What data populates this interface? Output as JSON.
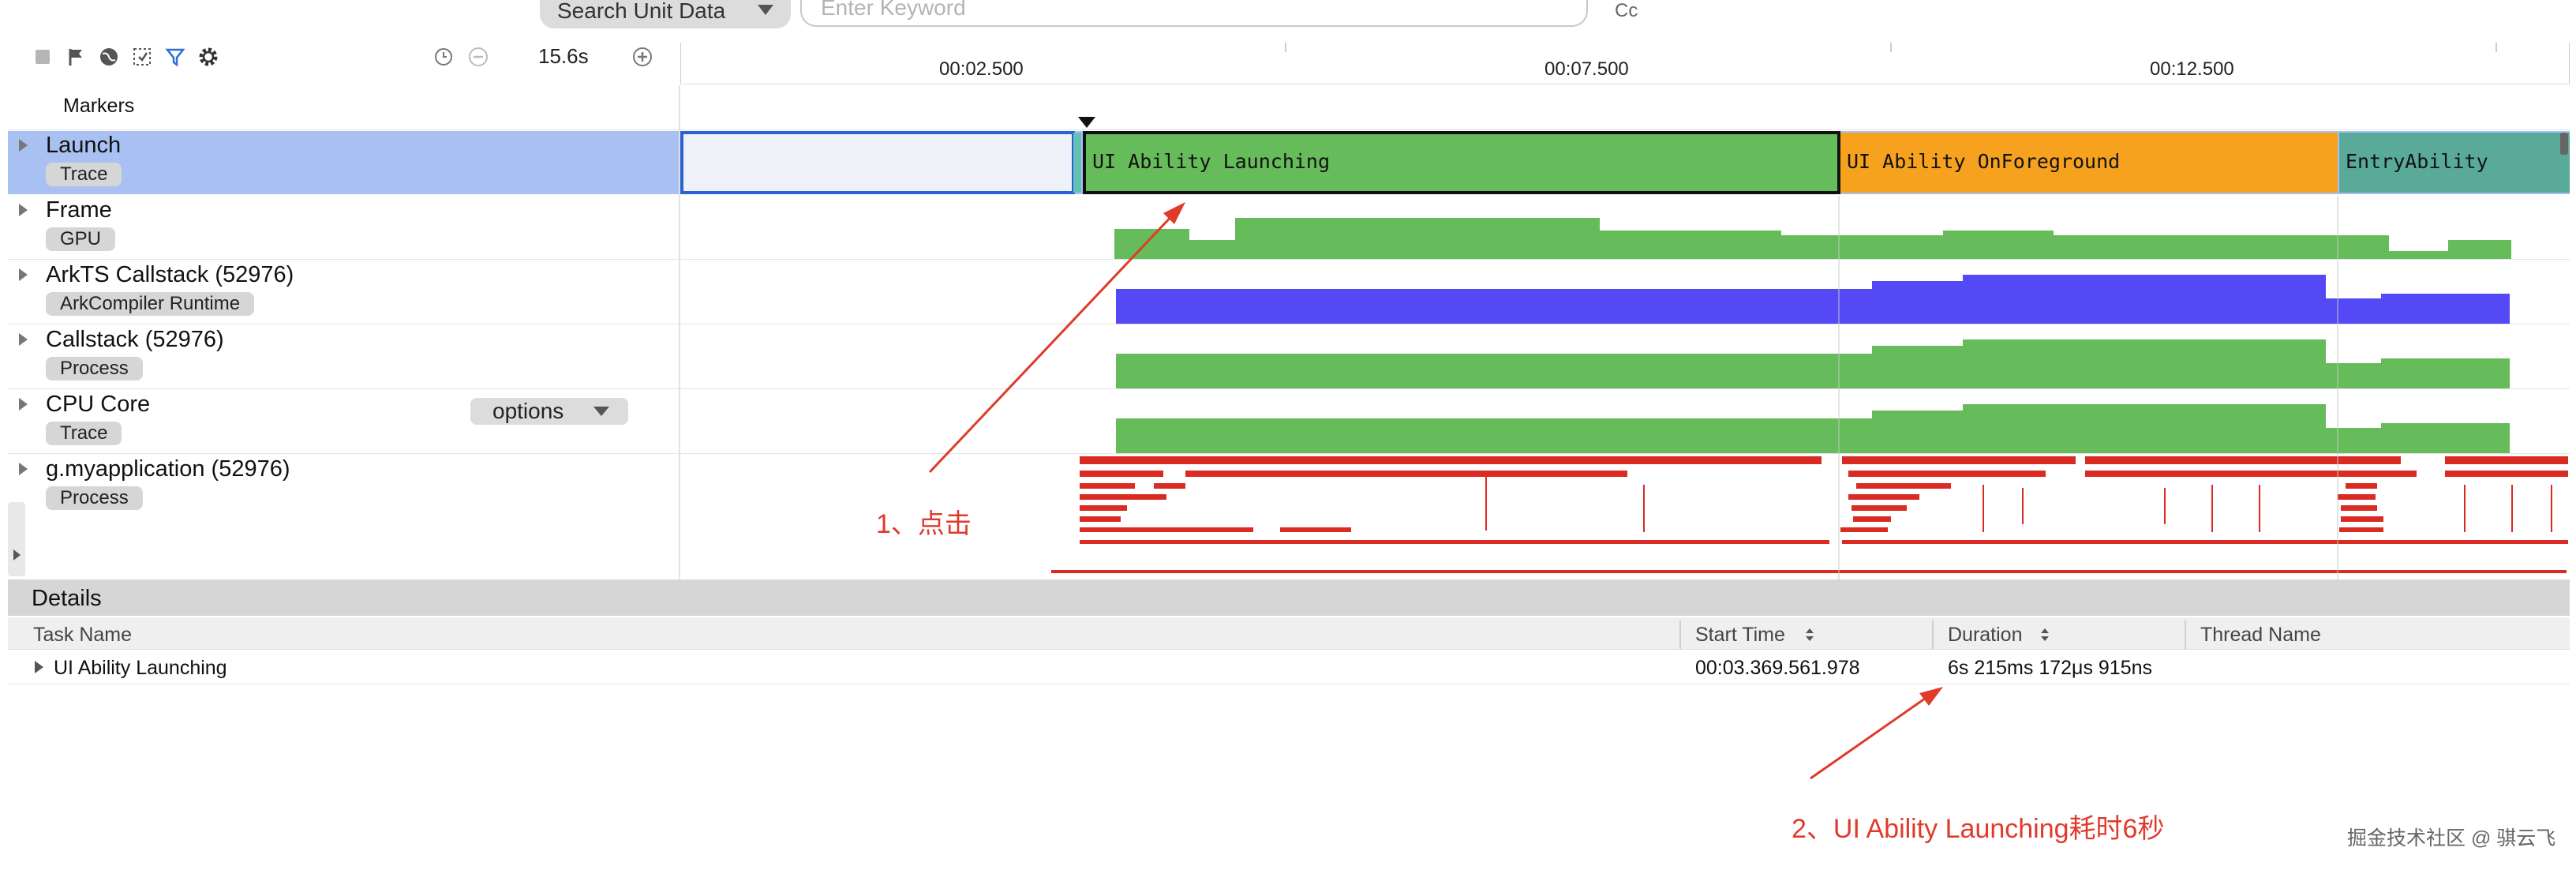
{
  "search": {
    "unit_label": "Search Unit Data",
    "keyword_placeholder": "Enter Keyword",
    "cc_label": "Cc"
  },
  "toolbar": {
    "zoom": "15.6s"
  },
  "ruler": {
    "ticks": [
      "00:02.500",
      "00:07.500",
      "00:12.500"
    ]
  },
  "markers_label": "Markers",
  "tracks": [
    {
      "title": "Launch",
      "badge": "Trace"
    },
    {
      "title": "Frame",
      "badge": "GPU"
    },
    {
      "title": "ArkTS Callstack (52976)",
      "badge": "ArkCompiler Runtime"
    },
    {
      "title": "Callstack (52976)",
      "badge": "Process"
    },
    {
      "title": "CPU Core",
      "badge": "Trace"
    },
    {
      "title": "g.myapplication (52976)",
      "badge": "Process"
    }
  ],
  "options_label": "options",
  "launch_slices": [
    {
      "label": "UI Ability Launching",
      "color": "#66bb5a"
    },
    {
      "label": "UI Ability OnForeground",
      "color": "#f7a21f"
    },
    {
      "label": "EntryAbility",
      "color": "#5aaa9a"
    }
  ],
  "colors": {
    "green": "#66bb5a",
    "blue": "#5548f5",
    "red": "#d92b22",
    "selection": "#a9c1f2",
    "annotation": "#e03a2b"
  },
  "details": {
    "title": "Details",
    "columns": [
      "Task Name",
      "Start Time",
      "Duration",
      "Thread Name"
    ],
    "row": {
      "task": "UI Ability Launching",
      "start": "00:03.369.561.978",
      "duration": "6s 215ms 172μs 915ns",
      "thread": ""
    }
  },
  "annotations": {
    "step1": "1、点击",
    "step2": "2、UI Ability Launching耗时6秒"
  },
  "watermark": "掘金技术社区 @ 骐云飞"
}
